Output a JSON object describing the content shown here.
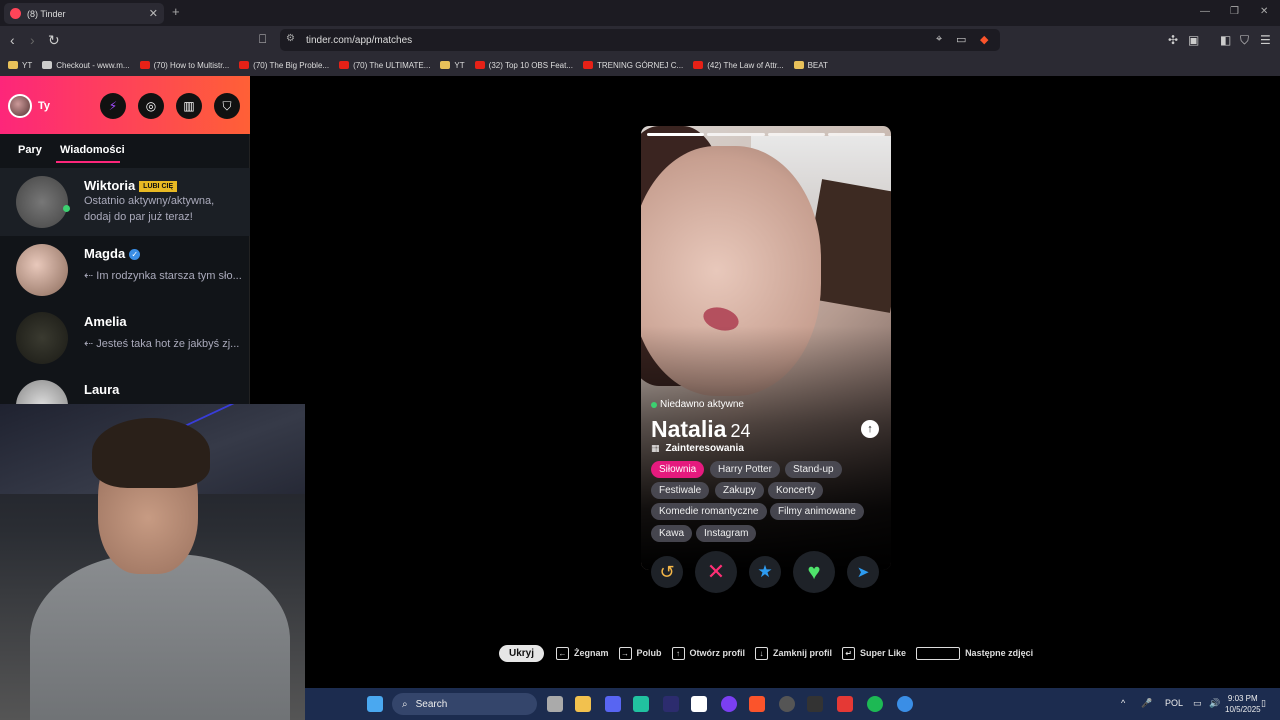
{
  "browser": {
    "tab_title": "(8) Tinder",
    "url": "tinder.com/app/matches",
    "bookmarks": [
      "Checkout - www.m...",
      "(70) How to Multistr...",
      "(70) The Big Proble...",
      "(70) The ULTIMATE...",
      "YT",
      "(32) Top 10 OBS Feat...",
      "TRENING GÓRNEJ C...",
      "(42) The Law of Attr...",
      "BEAT"
    ],
    "bookmark_folder_yt": "YT"
  },
  "sidebar": {
    "me_label": "Ty",
    "tabs": [
      "Pary",
      "Wiadomości"
    ],
    "matches": [
      {
        "name": "Wiktoria",
        "badge": "LUBI CIĘ",
        "message": "Ostatnio aktywny/aktywna, dodaj do par już teraz!"
      },
      {
        "name": "Magda",
        "message": "⇠ Im rodzynka starsza tym sło..."
      },
      {
        "name": "Amelia",
        "message": "⇠ Jesteś taka hot że jakbyś zj..."
      },
      {
        "name": "Laura",
        "message": ""
      }
    ]
  },
  "profile": {
    "status": "Niedawno aktywne",
    "name": "Natalia",
    "age": "24",
    "interests_title": "Zainteresowania",
    "interests": [
      "Siłownia",
      "Harry Potter",
      "Stand-up",
      "Festiwale",
      "Zakupy",
      "Koncerty",
      "Komedie romantyczne",
      "Filmy animowane",
      "Kawa",
      "Instagram"
    ],
    "photo_count": 4,
    "current_photo": 1
  },
  "hints": {
    "hide": "Ukryj",
    "nope": "Żegnam",
    "like": "Polub",
    "open": "Otwórz profil",
    "close": "Zamknij profil",
    "super": "Super Like",
    "next": "Następne zdjęci"
  },
  "taskbar": {
    "search": "Search",
    "lang": "POL",
    "time": "9:03 PM",
    "date": "10/5/2025"
  },
  "colors": {
    "brand_gradient_start": "#fd267a",
    "brand_gradient_end": "#ff6036",
    "online": "#3cd070",
    "like_badge": "#e8b923"
  }
}
